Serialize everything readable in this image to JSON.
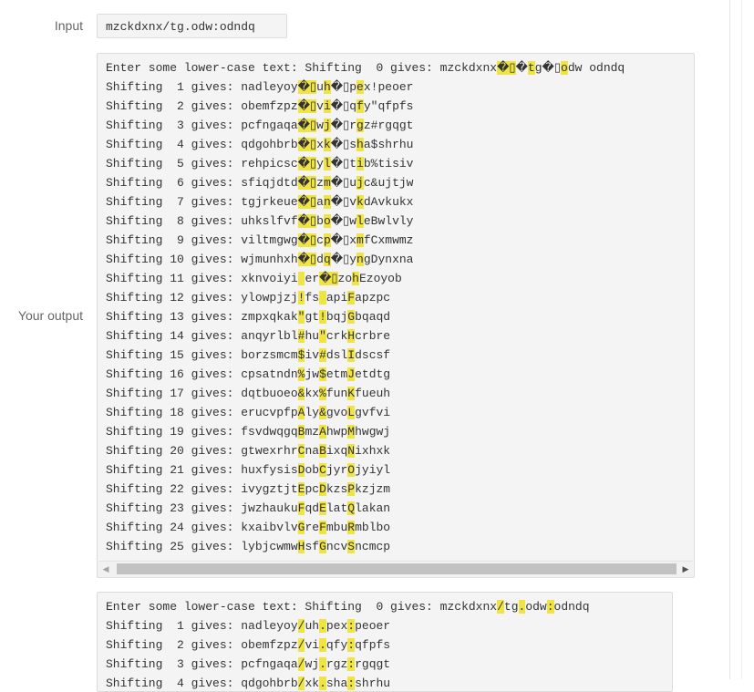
{
  "labels": {
    "input": "Input",
    "output": "Your output"
  },
  "input_value": "mzckdxnx/tg.odw:odndq",
  "output1": {
    "highlight_cols": [
      28,
      31,
      34,
      38
    ],
    "lines": [
      "Enter some lower-case text: Shifting  0 gives: mzckdxnx�▯�tg�▯odw odndq",
      "Shifting  1 gives: nadleyoy�▯uh�▯pex!peoer",
      "Shifting  2 gives: obemfzpz�▯vi�▯qfy\"qfpfs",
      "Shifting  3 gives: pcfngaqa�▯wj�▯rgz#rgqgt",
      "Shifting  4 gives: qdgohbrb�▯xk�▯sha$shrhu",
      "Shifting  5 gives: rehpicsc�▯yl�▯tib%tisiv",
      "Shifting  6 gives: sfiqjdtd�▯zm�▯ujc&ujtjw",
      "Shifting  7 gives: tgjrkeue�▯an�▯vkdAvkukx",
      "Shifting  8 gives: uhkslfvf�▯bo�▯wleBwlvly",
      "Shifting  9 gives: viltmgwg�▯cp�▯xmfCxmwmz",
      "Shifting 10 gives: wjmunhxh�▯dq�▯yngDynxna",
      "Shifting 11 gives: xknvoiyi er�▯zohEzoyob",
      "Shifting 12 gives: ylowpjzj!fs apiFapzpc",
      "Shifting 13 gives: zmpxqkak\"gt!bqjGbqaqd",
      "Shifting 14 gives: anqyrlbl#hu\"crkHcrbre",
      "Shifting 15 gives: borzsmcm$iv#dslIdscsf",
      "Shifting 16 gives: cpsatndn%jw$etmJetdtg",
      "Shifting 17 gives: dqtbuoeo&kx%funKfueuh",
      "Shifting 18 gives: erucvpfpAly&gvoLgvfvi",
      "Shifting 19 gives: fsvdwqgqBmzAhwpMhwgwj",
      "Shifting 20 gives: gtwexrhrCnaBixqNixhxk",
      "Shifting 21 gives: huxfysisDobCjyrOjyiyl",
      "Shifting 22 gives: ivygztjtEpcDkzsPkzjzm",
      "Shifting 23 gives: jwzhaukuFqdElatQlakan",
      "Shifting 24 gives: kxaibvlvGreFmbuRmblbo",
      "Shifting 25 gives: lybjcwmwHsfGncvSncmcp"
    ]
  },
  "output2": {
    "highlight_cols": [
      28,
      31,
      34,
      38
    ],
    "lines": [
      "Enter some lower-case text: Shifting  0 gives: mzckdxnx/tg.odw:odndq",
      "Shifting  1 gives: nadleyoy/uh.pex:peoer",
      "Shifting  2 gives: obemfzpz/vi.qfy:qfpfs",
      "Shifting  3 gives: pcfngaqa/wj.rgz:rgqgt",
      "Shifting  4 gives: qdgohbrb/xk.sha:shrhu"
    ]
  },
  "scrollbar": {
    "left_arrow": "◀",
    "right_arrow": "▶"
  },
  "colors": {
    "highlight": "#f0e442",
    "panel": "#f4f4f4"
  }
}
